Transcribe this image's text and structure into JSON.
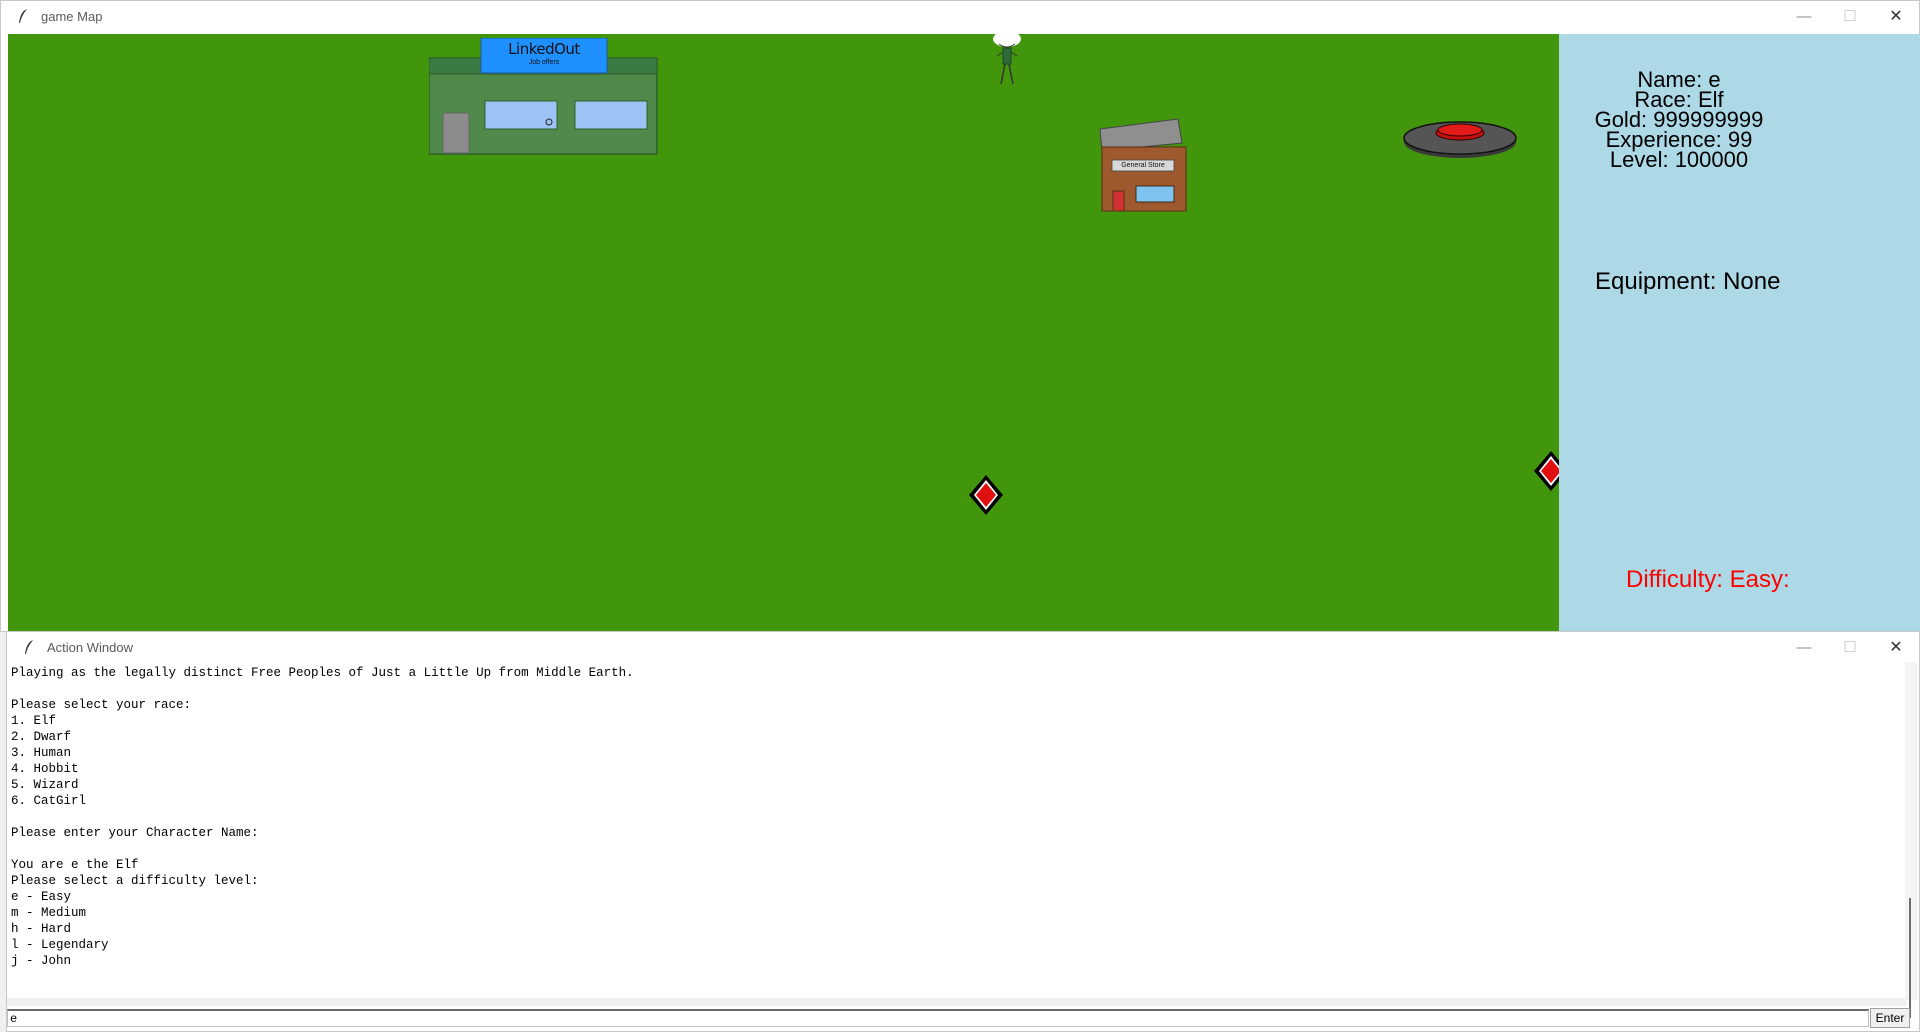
{
  "map_window": {
    "title": "game Map",
    "stats": {
      "name": "Name: e",
      "race": "Race: Elf",
      "gold": "Gold: 999999999",
      "experience": "Experience: 99",
      "level": "Level: 100000"
    },
    "equipment": "Equipment: None",
    "difficulty": "Difficulty: Easy:",
    "buildings": {
      "linkedout_sign": "LinkedOut",
      "linkedout_sub": "Job offers",
      "store_sign": "General Store"
    }
  },
  "action_window": {
    "title": "Action Window",
    "lines": [
      "Playing as the legally distinct Free Peoples of Just a Little Up from Middle Earth.",
      "",
      "Please select your race:",
      "1. Elf",
      "2. Dwarf",
      "3. Human",
      "4. Hobbit",
      "5. Wizard",
      "6. CatGirl",
      "",
      "Please enter your Character Name:",
      "",
      "You are e the Elf",
      "Please select a difficulty level:",
      "e - Easy",
      "m - Medium",
      "h - Hard",
      "l - Legendary",
      "j - John"
    ],
    "input_value": "e",
    "enter_label": "Enter"
  },
  "window_controls": {
    "minimize": "—",
    "maximize": "☐",
    "close": "✕"
  },
  "colors": {
    "grass": "#42960c",
    "panel": "#add8e6",
    "difficulty": "#ff0000"
  }
}
